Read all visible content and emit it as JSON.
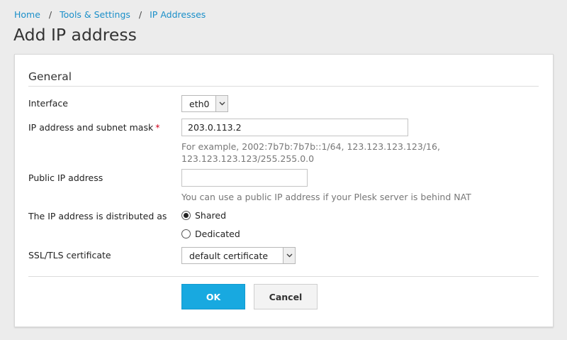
{
  "breadcrumb": {
    "items": [
      "Home",
      "Tools & Settings",
      "IP Addresses"
    ],
    "separator": "/"
  },
  "page": {
    "title": "Add IP address"
  },
  "form": {
    "section_title": "General",
    "interface": {
      "label": "Interface",
      "value": "eth0"
    },
    "ip_mask": {
      "label": "IP address and subnet mask",
      "required_marker": "*",
      "value": "203.0.113.2",
      "hint_line1": "For example, 2002:7b7b:7b7b::1/64, 123.123.123.123/16,",
      "hint_line2": "123.123.123.123/255.255.0.0"
    },
    "public_ip": {
      "label": "Public IP address",
      "value": "",
      "hint": "You can use a public IP address if your Plesk server is behind NAT"
    },
    "distribution": {
      "label": "The IP address is distributed as",
      "options": [
        "Shared",
        "Dedicated"
      ],
      "selected": "Shared"
    },
    "ssl": {
      "label": "SSL/TLS certificate",
      "value": "default certificate"
    },
    "buttons": {
      "ok": "OK",
      "cancel": "Cancel"
    }
  },
  "colors": {
    "accent": "#18a9e0",
    "link": "#1a8fc9",
    "required": "#d0021b"
  }
}
